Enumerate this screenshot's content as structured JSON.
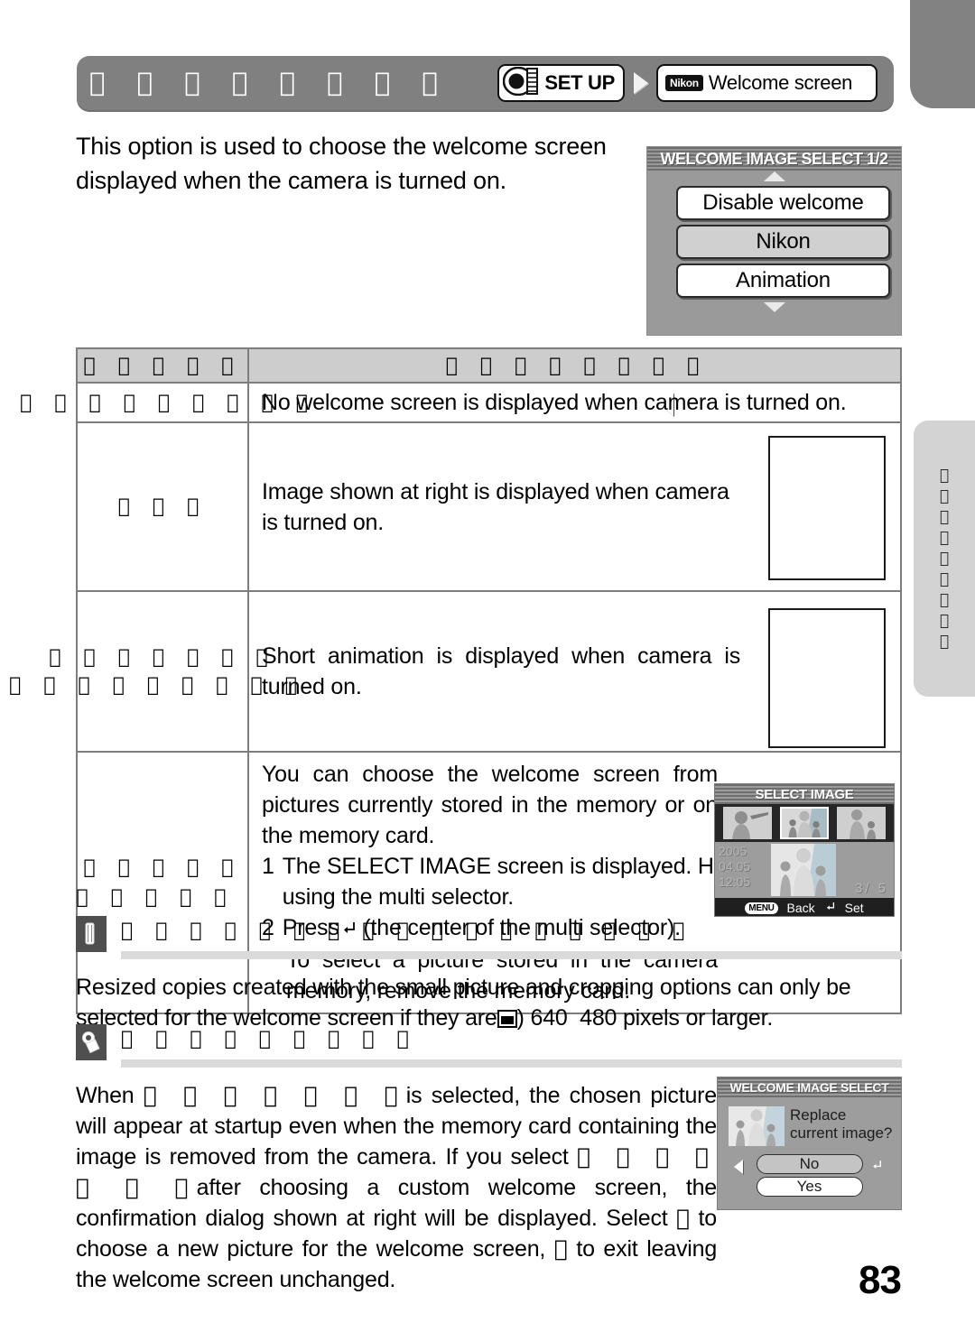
{
  "page": {
    "number": "83",
    "header": {
      "title_tofu": "􀀀 􀀀 􀀀 􀀀 􀀀 􀀀 􀀀 􀀀",
      "setup_label": "SET UP",
      "nikon_logo": "Nikon",
      "menu_label": "Welcome screen",
      "lens_icon": "lens-dial-icon",
      "arrow_icon": "arrow-right-icon"
    },
    "intro": "This option is used to choose the welcome screen displayed when the camera is turned on."
  },
  "lcd_welcome": {
    "title": "WELCOME IMAGE SELECT 1/2",
    "arrow_up": "scroll-up-arrow",
    "arrow_down": "scroll-down-arrow",
    "cursor": "left-cursor-arrow",
    "items": [
      {
        "label": "Disable welcome",
        "selected": false
      },
      {
        "label": "Nikon",
        "selected": true
      },
      {
        "label": "Animation",
        "selected": false
      }
    ]
  },
  "table": {
    "header": {
      "col1_tofu": "􀀀 􀀀 􀀀 􀀀 􀀀",
      "col2_tofu": "􀀀 􀀀 􀀀 􀀀 􀀀 􀀀 􀀀 􀀀"
    },
    "rows": [
      {
        "c1_tofu": "􀀀 􀀀 􀀀 􀀀 􀀀 􀀀 􀀀 􀀀 􀀀",
        "c2_text": "No welcome screen is displayed when camera is turned on."
      },
      {
        "c1_tofu": "􀀀 􀀀 􀀀",
        "c2_text": "Image shown at right is displayed when camera is turned on.",
        "thumb": "sample-welcome-image"
      },
      {
        "c1_tofu_line1": "􀀀 􀀀 􀀀 􀀀 􀀀 􀀀 􀀀",
        "c1_tofu_line2": "􀀀 􀀀 􀀀 􀀀 􀀀 􀀀 􀀀 􀀀 􀀀",
        "c2_text": "Short animation is displayed when camera is turned on.",
        "thumb": "sample-animation-image"
      },
      {
        "c1_tofu_line1": "􀀀 􀀀 􀀀 􀀀 􀀀",
        "c1_tofu_line2": "􀀀 􀀀 􀀀 􀀀 􀀀",
        "c2_intro": "You can choose the welcome screen from pictures currently stored in the memory or on the memory card.",
        "step1_num": "1",
        "step1_text": "The SELECT IMAGE screen is displayed. Highlight a picture using the multi selector.",
        "step2_num": "2",
        "step2_text_a": "Press",
        "step2_text_b": "(the center of the multi selector).",
        "step2_text_c": "To select a picture stored in the camera memory, remove the memory card.",
        "enter_icon": "enter-key-icon"
      }
    ]
  },
  "lcd_select_image": {
    "title": "SELECT IMAGE",
    "date_line1": "2005",
    "date_line2": "04.05",
    "date_line3": "12:05",
    "counter": "3/  5",
    "back_key": "MENU",
    "back_label": "Back",
    "set_key": "enter-icon",
    "set_label": "Set"
  },
  "note1": {
    "icon": "pencil-note-icon",
    "heading_tofu": "􀀀 􀀀 􀀀 􀀀 􀀀 􀀀 􀀀 􀀀 􀀀 􀀀 􀀀 􀀀 􀀀 􀀀 􀀀 􀀀 􀀀",
    "text_a": "Resized copies created with the small picture and cropping options can only be selected for the welcome screen if they are",
    "icon_inline": "small-picture-icon",
    "text_b": ") 640",
    "text_c": "480 pixels or larger."
  },
  "note2": {
    "icon": "camera-playback-icon",
    "heading_tofu": "􀀀 􀀀 􀀀 􀀀 􀀀 􀀀 􀀀 􀀀 􀀀",
    "t1": "When",
    "tofu1": "􀀀 􀀀 􀀀 􀀀 􀀀 􀀀 􀀀",
    "t2": "is selected, the chosen picture will appear at startup even when the memory card containing the image is removed from the camera. If you select",
    "tofu2": "􀀀 􀀀 􀀀 􀀀 􀀀 􀀀 􀀀",
    "t3": "after choosing a custom welcome screen, the confirmation dialog shown at right will be displayed. Select",
    "tofu3": "􀀀",
    "t4": "to choose a new picture for the welcome screen,",
    "tofu4": "􀀀",
    "t5": "to exit leaving the welcome screen unchanged."
  },
  "lcd_confirm": {
    "title": "WELCOME IMAGE SELECT",
    "message": "Replace current image?",
    "thumb": "selected-picture-thumbnail",
    "buttons": [
      {
        "label": "No",
        "selected": true
      },
      {
        "label": "Yes",
        "selected": false
      }
    ],
    "left_arrow": "left-cursor-arrow",
    "enter_icon": "enter-key-icon"
  },
  "side_tab": {
    "labels_tofu": [
      "􀀀",
      "􀀀",
      "􀀀",
      "􀀀",
      "􀀀",
      "􀀀",
      "􀀀",
      "􀀀",
      "􀀀"
    ]
  }
}
